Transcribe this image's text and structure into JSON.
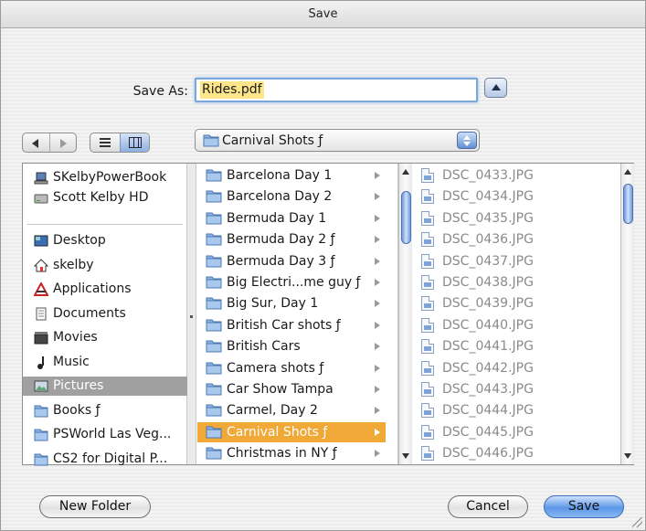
{
  "window": {
    "title": "Save"
  },
  "save_as": {
    "label": "Save As:",
    "value": "Rides.pdf"
  },
  "path_popup": {
    "label": "Carnival Shots ƒ"
  },
  "sidebar": {
    "devices": [
      {
        "label": "SKelbyPowerBook",
        "icon": "laptop-icon"
      },
      {
        "label": "Scott Kelby HD",
        "icon": "hard-drive-icon"
      }
    ],
    "places": [
      {
        "label": "Desktop",
        "icon": "desktop-icon"
      },
      {
        "label": "skelby",
        "icon": "home-icon"
      },
      {
        "label": "Applications",
        "icon": "applications-icon"
      },
      {
        "label": "Documents",
        "icon": "documents-icon"
      },
      {
        "label": "Movies",
        "icon": "movies-icon"
      },
      {
        "label": "Music",
        "icon": "music-icon"
      },
      {
        "label": "Pictures",
        "icon": "pictures-icon",
        "selected": true
      },
      {
        "label": "Books ƒ",
        "icon": "folder-icon"
      },
      {
        "label": "PSWorld Las Veg...",
        "icon": "folder-icon"
      },
      {
        "label": "CS2 for Digital P...",
        "icon": "folder-icon"
      }
    ]
  },
  "folders": [
    "Barcelona Day 1",
    "Barcelona Day 2",
    "Bermuda Day 1",
    "Bermuda Day 2 ƒ",
    "Bermuda Day 3 ƒ",
    "Big Electri...me guy ƒ",
    "Big Sur, Day 1",
    "British Car shots ƒ",
    "British Cars",
    "Camera shots ƒ",
    "Car Show Tampa",
    "Carmel, Day 2",
    "Carnival Shots ƒ",
    "Christmas in NY ƒ"
  ],
  "selected_folder": "Carnival Shots ƒ",
  "files": [
    "DSC_0433.JPG",
    "DSC_0434.JPG",
    "DSC_0435.JPG",
    "DSC_0436.JPG",
    "DSC_0437.JPG",
    "DSC_0438.JPG",
    "DSC_0439.JPG",
    "DSC_0440.JPG",
    "DSC_0441.JPG",
    "DSC_0442.JPG",
    "DSC_0443.JPG",
    "DSC_0444.JPG",
    "DSC_0445.JPG",
    "DSC_0446.JPG"
  ],
  "buttons": {
    "new_folder": "New Folder",
    "cancel": "Cancel",
    "save": "Save"
  },
  "colors": {
    "selection_orange": "#f0a837",
    "sidebar_selected": "#a0a0a0",
    "aqua_blue": "#5c97e8",
    "saveas_highlight": "#fde68a"
  }
}
